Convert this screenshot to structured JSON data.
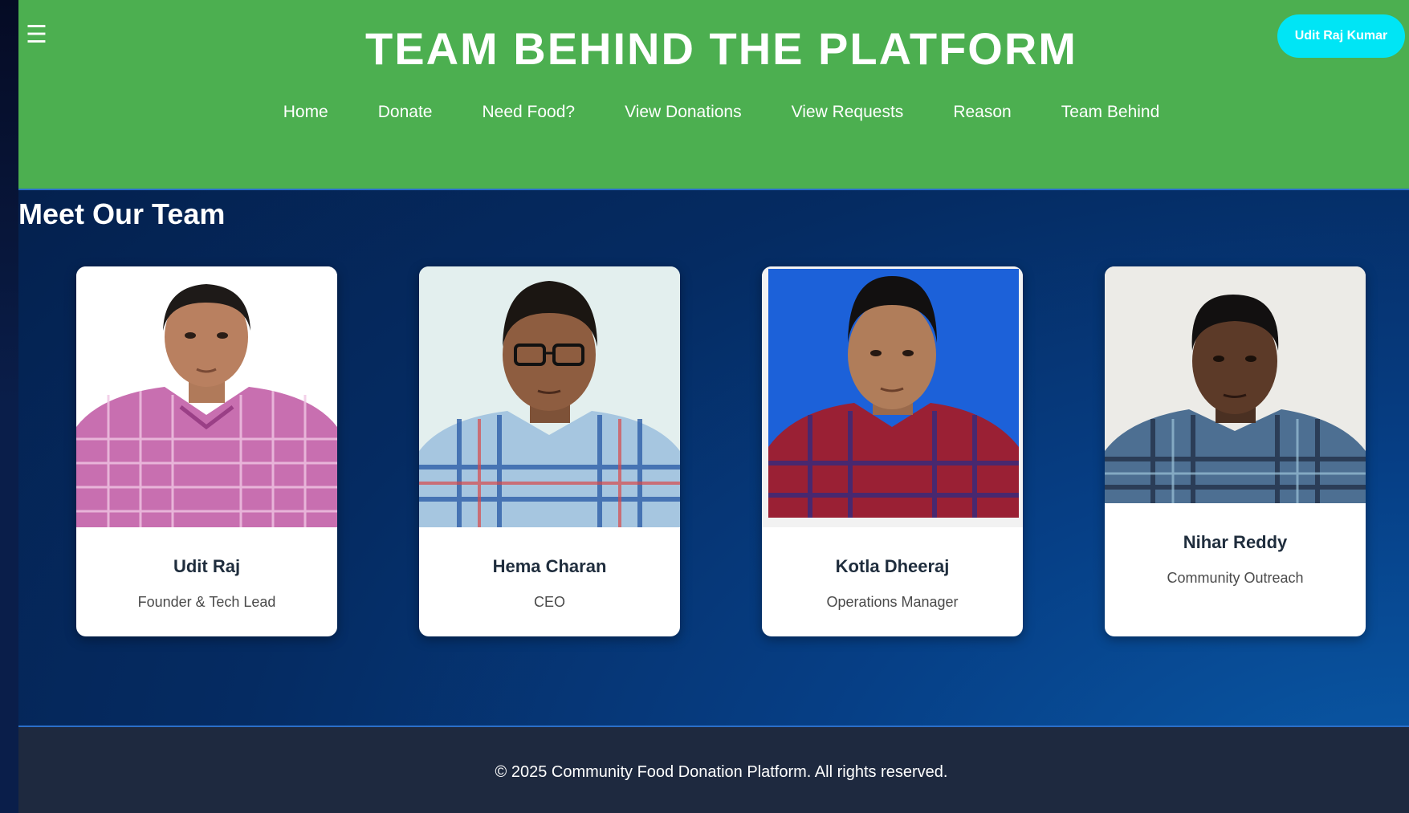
{
  "header": {
    "menu_icon": "hamburger-icon",
    "title": "TEAM BEHIND THE PLATFORM",
    "user_button": "Udit Raj Kumar",
    "nav": [
      "Home",
      "Donate",
      "Need Food?",
      "View Donations",
      "View Requests",
      "Reason",
      "Team Behind"
    ]
  },
  "main": {
    "section_title": "Meet Our Team",
    "members": [
      {
        "name": "Udit Raj",
        "role": "Founder & Tech Lead"
      },
      {
        "name": "Hema Charan",
        "role": "CEO"
      },
      {
        "name": "Kotla Dheeraj",
        "role": "Operations Manager"
      },
      {
        "name": "Nihar Reddy",
        "role": "Community Outreach"
      }
    ]
  },
  "footer": {
    "text": "© 2025 Community Food Donation Platform. All rights reserved."
  },
  "colors": {
    "header_bg": "#4caf50",
    "user_button_bg": "#00e5f5",
    "page_bg": "#052b62",
    "footer_bg": "#1e293f"
  }
}
